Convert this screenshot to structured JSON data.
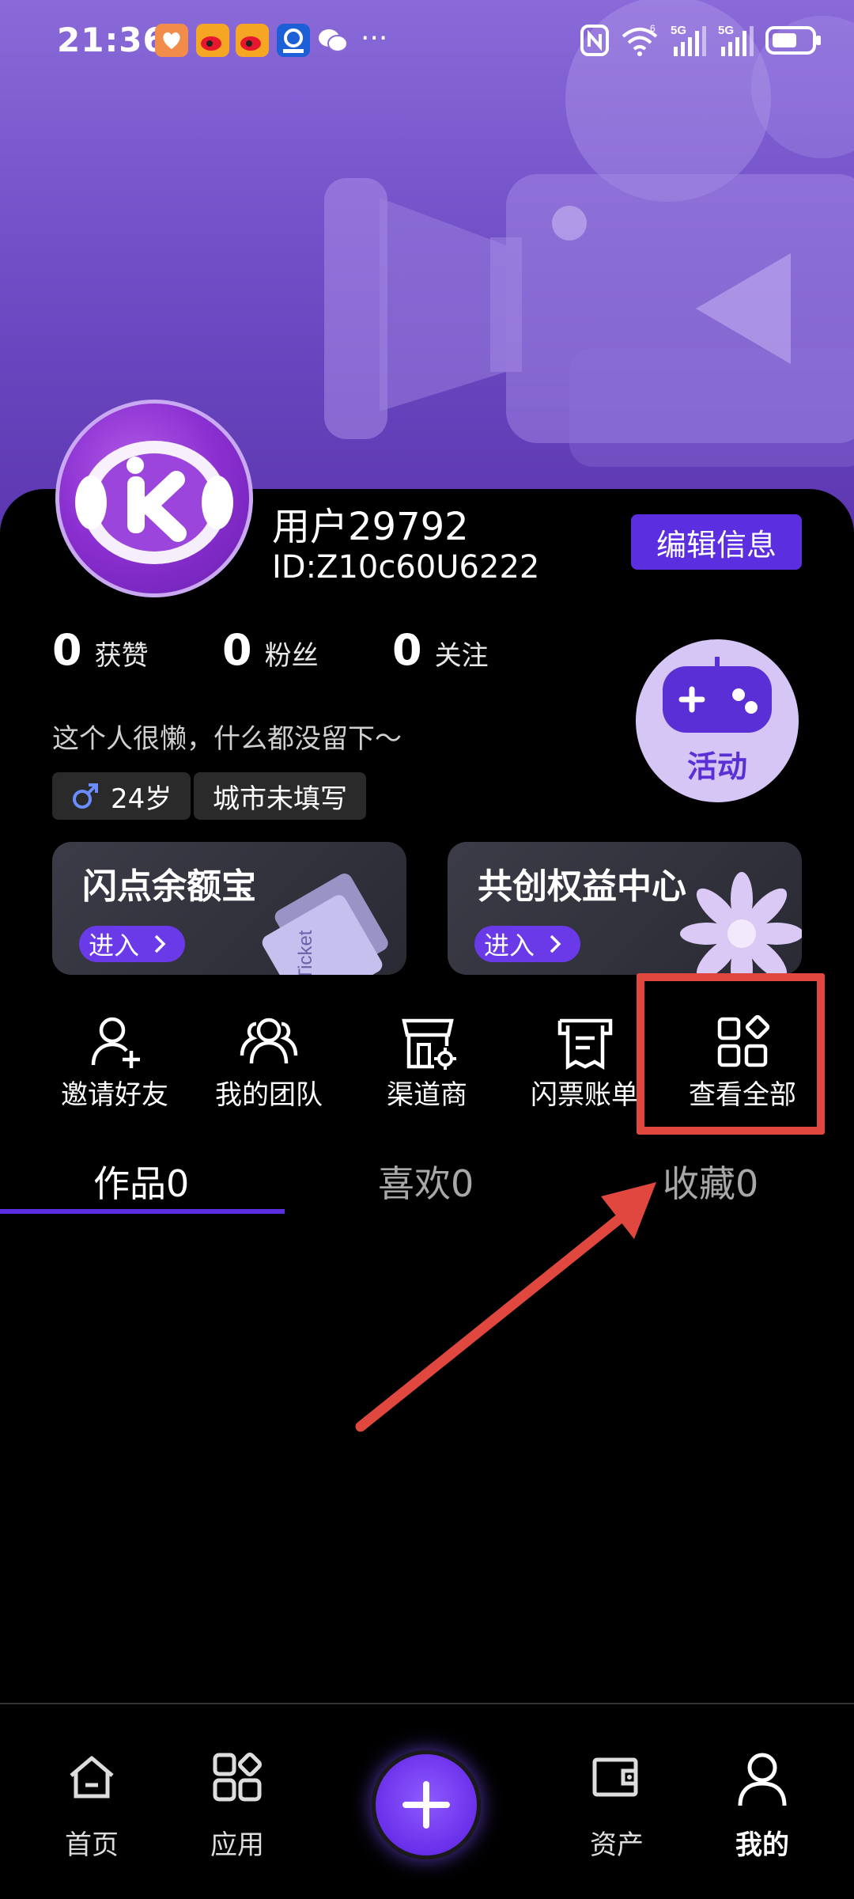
{
  "status_bar": {
    "time": "21:36",
    "network_labels": [
      "6",
      "5G",
      "5G"
    ]
  },
  "profile": {
    "username": "用户29792",
    "user_id": "ID:Z10c60U6222",
    "edit_button": "编辑信息",
    "stats": [
      {
        "value": "0",
        "label": "获赞"
      },
      {
        "value": "0",
        "label": "粉丝"
      },
      {
        "value": "0",
        "label": "关注"
      }
    ],
    "bio": "这个人很懒，什么都没留下～",
    "tags": {
      "age": "24岁",
      "city": "城市未填写"
    },
    "activity_label": "活动"
  },
  "cards": [
    {
      "title": "闪点余额宝",
      "enter": "进入",
      "image_text": "Ticket"
    },
    {
      "title": "共创权益中心",
      "enter": "进入"
    }
  ],
  "shortcuts": [
    {
      "label": "邀请好友",
      "icon": "add-user-icon"
    },
    {
      "label": "我的团队",
      "icon": "team-icon"
    },
    {
      "label": "渠道商",
      "icon": "store-icon"
    },
    {
      "label": "闪票账单",
      "icon": "receipt-icon"
    },
    {
      "label": "查看全部",
      "icon": "grid-icon"
    }
  ],
  "tabs": [
    {
      "label": "作品0",
      "active": true
    },
    {
      "label": "喜欢0",
      "active": false
    },
    {
      "label": "收藏0",
      "active": false
    }
  ],
  "bottom_nav": [
    {
      "label": "首页",
      "icon": "home-icon",
      "active": false
    },
    {
      "label": "应用",
      "icon": "apps-icon",
      "active": false
    },
    {
      "label": "",
      "icon": "plus-icon",
      "active": false
    },
    {
      "label": "资产",
      "icon": "wallet-icon",
      "active": false
    },
    {
      "label": "我的",
      "icon": "user-icon",
      "active": true
    }
  ],
  "colors": {
    "accent": "#5b2ee0",
    "annotation_red": "#e0473e",
    "background": "#000000",
    "header_gradient_top": "#8a6ad8"
  }
}
